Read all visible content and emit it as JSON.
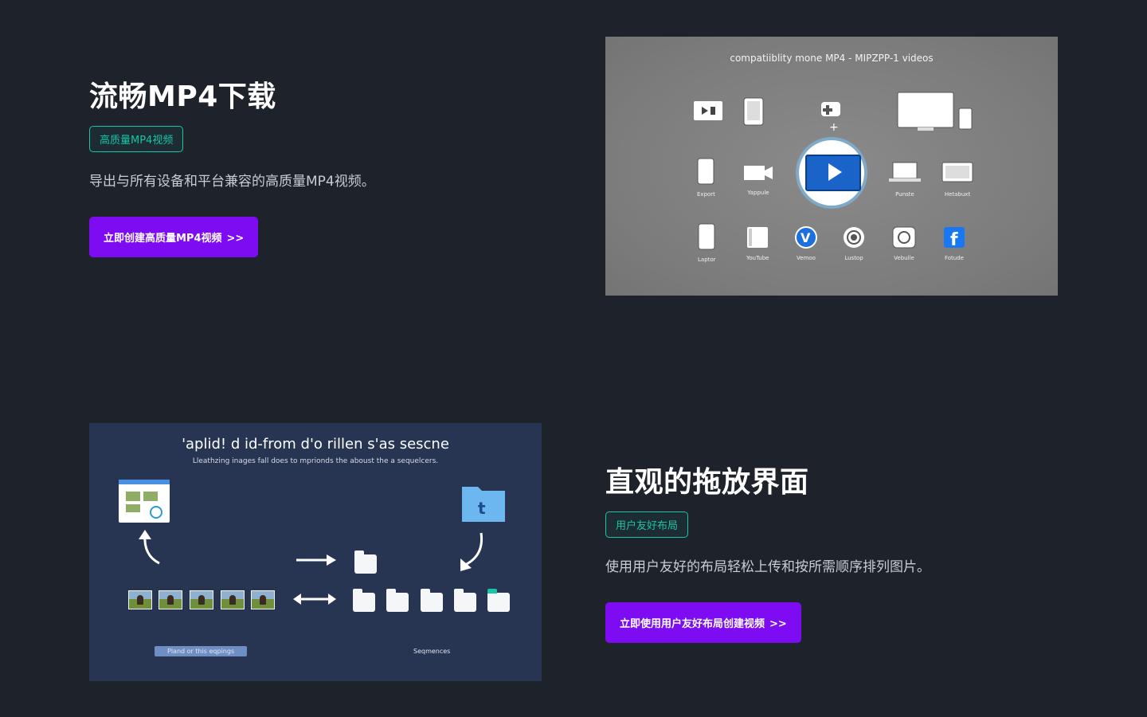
{
  "section1": {
    "title": "流畅MP4下载",
    "tag": "高质量MP4视频",
    "description": "导出与所有设备和平台兼容的高质量MP4视频。",
    "cta_label": "立即创建高质量MP4视频",
    "cta_arrows": ">>"
  },
  "section2": {
    "title": "直观的拖放界面",
    "tag": "用户友好布局",
    "description": "使用用户友好的布局轻松上传和按所需顺序排列图片。",
    "cta_label": "立即使用用户友好布局创建视频",
    "cta_arrows": ">>"
  },
  "image1": {
    "caption": "compatiiblity mone MP4 - MIPZPP-1 videos",
    "row2_labels": [
      "Export",
      "Yappule",
      "Punste",
      "Hetabuxt"
    ],
    "row3_labels": [
      "Laptor",
      "YouTube",
      "Vemoo",
      "Lustop",
      "Vebulle",
      "Fotude"
    ]
  },
  "image2": {
    "heading": "'aplid! d id-from d'o rillen s'as sescne",
    "subheading": "Lleathzing inages fall does to mprionds the aboust the a sequelcers.",
    "left_label": "Pland or this eqpings",
    "right_label": "Seqmences"
  },
  "colors": {
    "background": "#1e222b",
    "accent_teal": "#19c4a8",
    "cta_purple": "#7d0cf3"
  }
}
